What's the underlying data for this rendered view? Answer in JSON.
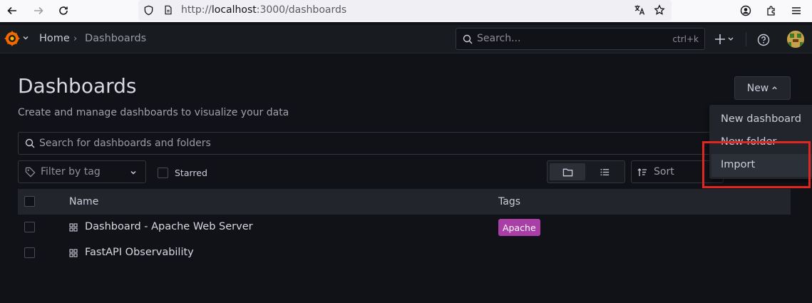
{
  "browser": {
    "url_scheme": "http://",
    "url_host": "localhost",
    "url_path": ":3000/dashboards"
  },
  "topnav": {
    "breadcrumb_home": "Home",
    "breadcrumb_sep": "›",
    "breadcrumb_current": "Dashboards",
    "search_placeholder": "Search...",
    "search_shortcut": "ctrl+k"
  },
  "page": {
    "title": "Dashboards",
    "subtitle": "Create and manage dashboards to visualize your data",
    "new_button": "New",
    "search_placeholder": "Search for dashboards and folders",
    "filter_placeholder": "Filter by tag",
    "starred_label": "Starred",
    "sort_label": "Sort"
  },
  "new_menu": {
    "items": [
      "New dashboard",
      "New folder",
      "Import"
    ]
  },
  "table": {
    "columns": [
      "Name",
      "Tags"
    ],
    "rows": [
      {
        "name": "Dashboard - Apache Web Server",
        "tags": [
          "Apache"
        ]
      },
      {
        "name": "FastAPI Observability",
        "tags": []
      }
    ]
  },
  "colors": {
    "tag_apache": "#a93ea7",
    "highlight": "#e0261e",
    "grafana_orange": "#f46800"
  }
}
